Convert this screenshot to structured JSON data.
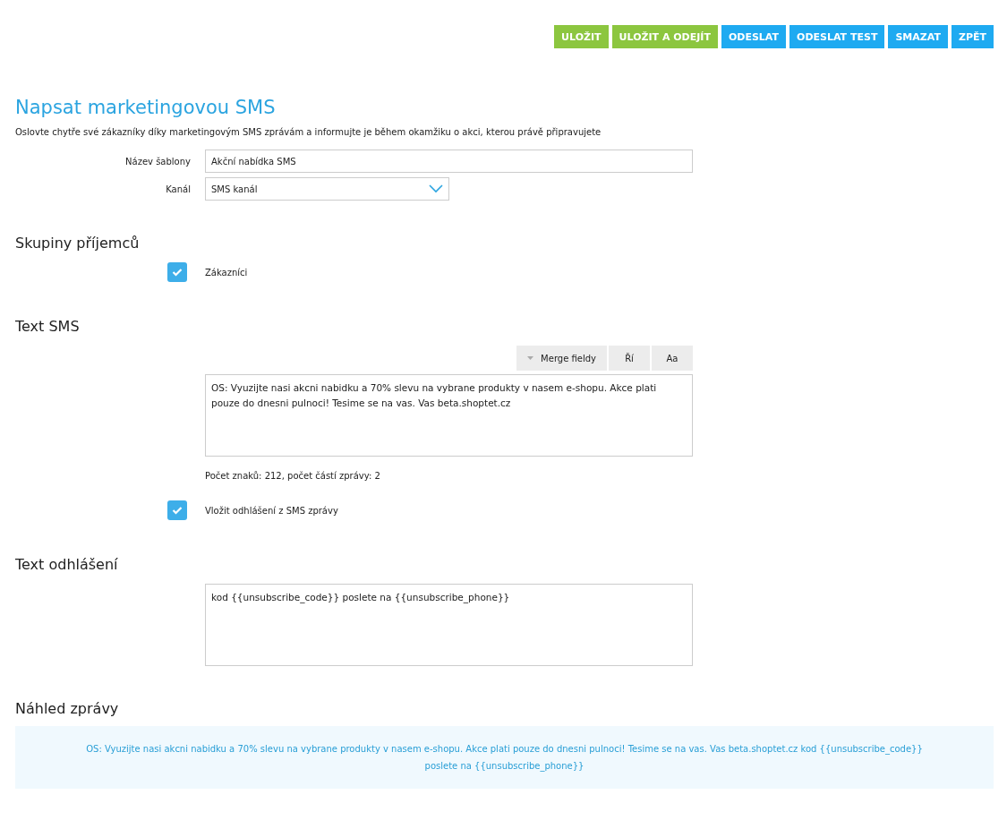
{
  "toolbar": [
    {
      "label": "ULOŽIT",
      "kind": "save"
    },
    {
      "label": "ULOŽIT A ODEJÍT",
      "kind": "save"
    },
    {
      "label": "ODESLAT",
      "kind": "action"
    },
    {
      "label": "ODESLAT TEST",
      "kind": "action"
    },
    {
      "label": "SMAZAT",
      "kind": "action"
    },
    {
      "label": "ZPĚT",
      "kind": "action"
    }
  ],
  "title": "Napsat marketingovou SMS",
  "description": "Oslovte chytře své zákazníky díky marketingovým SMS zprávám a informujte je během okamžiku o akci, kterou právě připravujete",
  "template_name": {
    "label": "Název šablony",
    "value": "Akční nabídka SMS"
  },
  "channel": {
    "label": "Kanál",
    "value": "SMS kanál"
  },
  "recipients": {
    "heading": "Skupiny příjemců",
    "groups": [
      {
        "label": "Zákazníci",
        "checked": true
      }
    ]
  },
  "sms_text": {
    "heading": "Text SMS",
    "editor_buttons": [
      "Merge fieldy",
      "Ří",
      "Aa"
    ],
    "value": "OS: Vyuzijte nasi akcni nabidku a 70% slevu na vybrane produkty v nasem e-shopu. Akce plati pouze do dnesni pulnoci! Tesime se na vas. Vas beta.shoptet.cz",
    "counter": "Počet znaků: 212, počet částí zprávy: 2",
    "unsubscribe": {
      "label": "Vložit odhlášení z SMS zprávy",
      "checked": true
    }
  },
  "unsubscribe_text": {
    "heading": "Text odhlášení",
    "value": "kod {{unsubscribe_code}} poslete na {{unsubscribe_phone}}"
  },
  "preview": {
    "heading": "Náhled zprávy",
    "text": "OS: Vyuzijte nasi akcni nabidku a 70% slevu na vybrane produkty v nasem e-shopu. Akce plati pouze do dnesni pulnoci! Tesime se na vas. Vas beta.shoptet.cz kod {{unsubscribe_code}} poslete na {{unsubscribe_phone}}"
  }
}
